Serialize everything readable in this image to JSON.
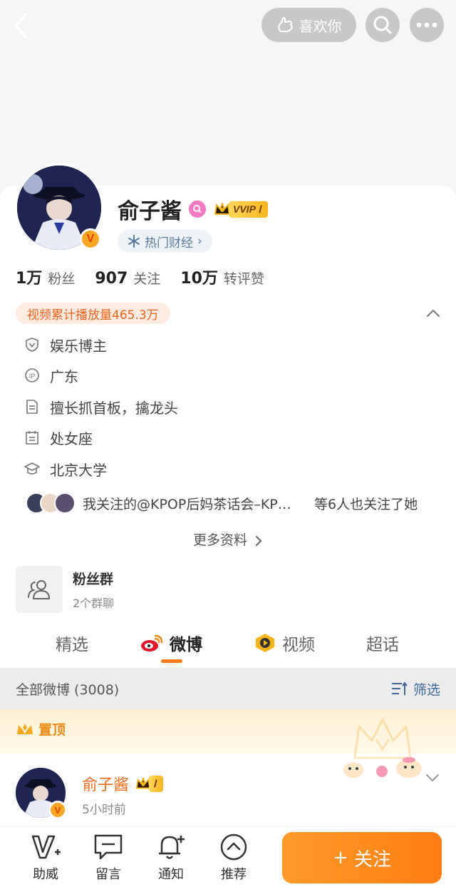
{
  "header": {
    "like_label": "喜欢你"
  },
  "profile": {
    "name": "俞子酱",
    "vip_label": "VVIP Ⅰ",
    "hot_tag": "热门财经",
    "hot_tag_arrow": "›",
    "stats": [
      {
        "value": "1万",
        "label": "粉丝"
      },
      {
        "value": "907",
        "label": "关注"
      },
      {
        "value": "10万",
        "label": "转评赞"
      }
    ],
    "video_plays": "视频累计播放量465.3万",
    "info": [
      {
        "icon": "shield-v-icon",
        "text": "娱乐博主"
      },
      {
        "icon": "ip-icon",
        "text": "广东"
      },
      {
        "icon": "document-icon",
        "text": "擅长抓首板，擒龙头"
      },
      {
        "icon": "calendar-icon",
        "text": "处女座"
      },
      {
        "icon": "graduation-cap-icon",
        "text": "北京大学"
      }
    ],
    "mutual_follow_text": "我关注的@KPOP后妈茶话会–KPOP后妈茶话会",
    "mutual_follow_tail": "等6人也关注了她",
    "more_info": "更多资料",
    "verified_mark": "V"
  },
  "fan_group": {
    "title": "粉丝群",
    "subtitle": "2个群聊"
  },
  "tabs": [
    {
      "label": "精选",
      "active": false
    },
    {
      "label": "微博",
      "active": true
    },
    {
      "label": "视频",
      "active": false
    },
    {
      "label": "超话",
      "active": false
    }
  ],
  "feed": {
    "filter_label": "全部微博 (3008)",
    "filter_button": "筛选",
    "pinned_label": "置顶",
    "post": {
      "author": "俞子酱",
      "badge": "Ⅰ",
      "time": "5小时前"
    }
  },
  "bottom_bar": {
    "items": [
      {
        "label": "助威",
        "icon": "cheer-v-icon"
      },
      {
        "label": "留言",
        "icon": "message-icon"
      },
      {
        "label": "通知",
        "icon": "bell-plus-icon"
      },
      {
        "label": "推荐",
        "icon": "recommend-up-icon"
      }
    ],
    "follow_label": "关注",
    "follow_plus": "+"
  },
  "colors": {
    "accent": "#ff7d14",
    "link": "#3e6796",
    "name_orange": "#f26a1a"
  }
}
